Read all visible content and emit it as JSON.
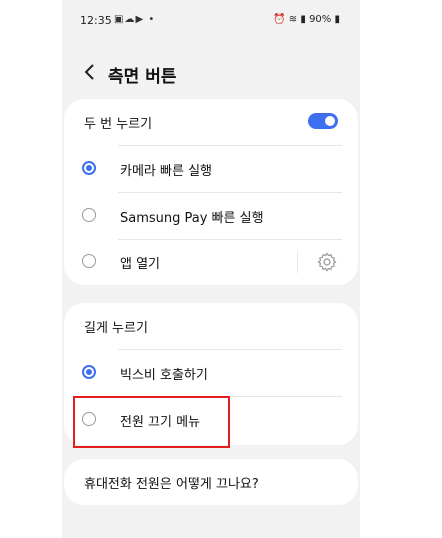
{
  "status_bar": {
    "time": "12:35",
    "left_icons": [
      "gallery-icon",
      "cloud-icon",
      "youtube-icon",
      "dot-icon"
    ],
    "battery": "90%"
  },
  "header": {
    "title": "측면 버튼"
  },
  "double_press": {
    "title": "두 번 누르기",
    "toggle_on": true,
    "options": [
      {
        "label": "카메라 빠른 실행",
        "selected": true
      },
      {
        "label": "Samsung Pay 빠른 실행",
        "selected": false
      },
      {
        "label": "앱 열기",
        "selected": false
      }
    ]
  },
  "long_press": {
    "title": "길게 누르기",
    "options": [
      {
        "label": "빅스비 호출하기",
        "selected": true
      },
      {
        "label": "전원 끄기 메뉴",
        "selected": false
      }
    ]
  },
  "help_link": "휴대전화 전원은 어떻게 끄나요?",
  "colors": {
    "accent": "#3d6ff0",
    "highlight": "#e31e1e",
    "background": "#f2f2f2"
  }
}
